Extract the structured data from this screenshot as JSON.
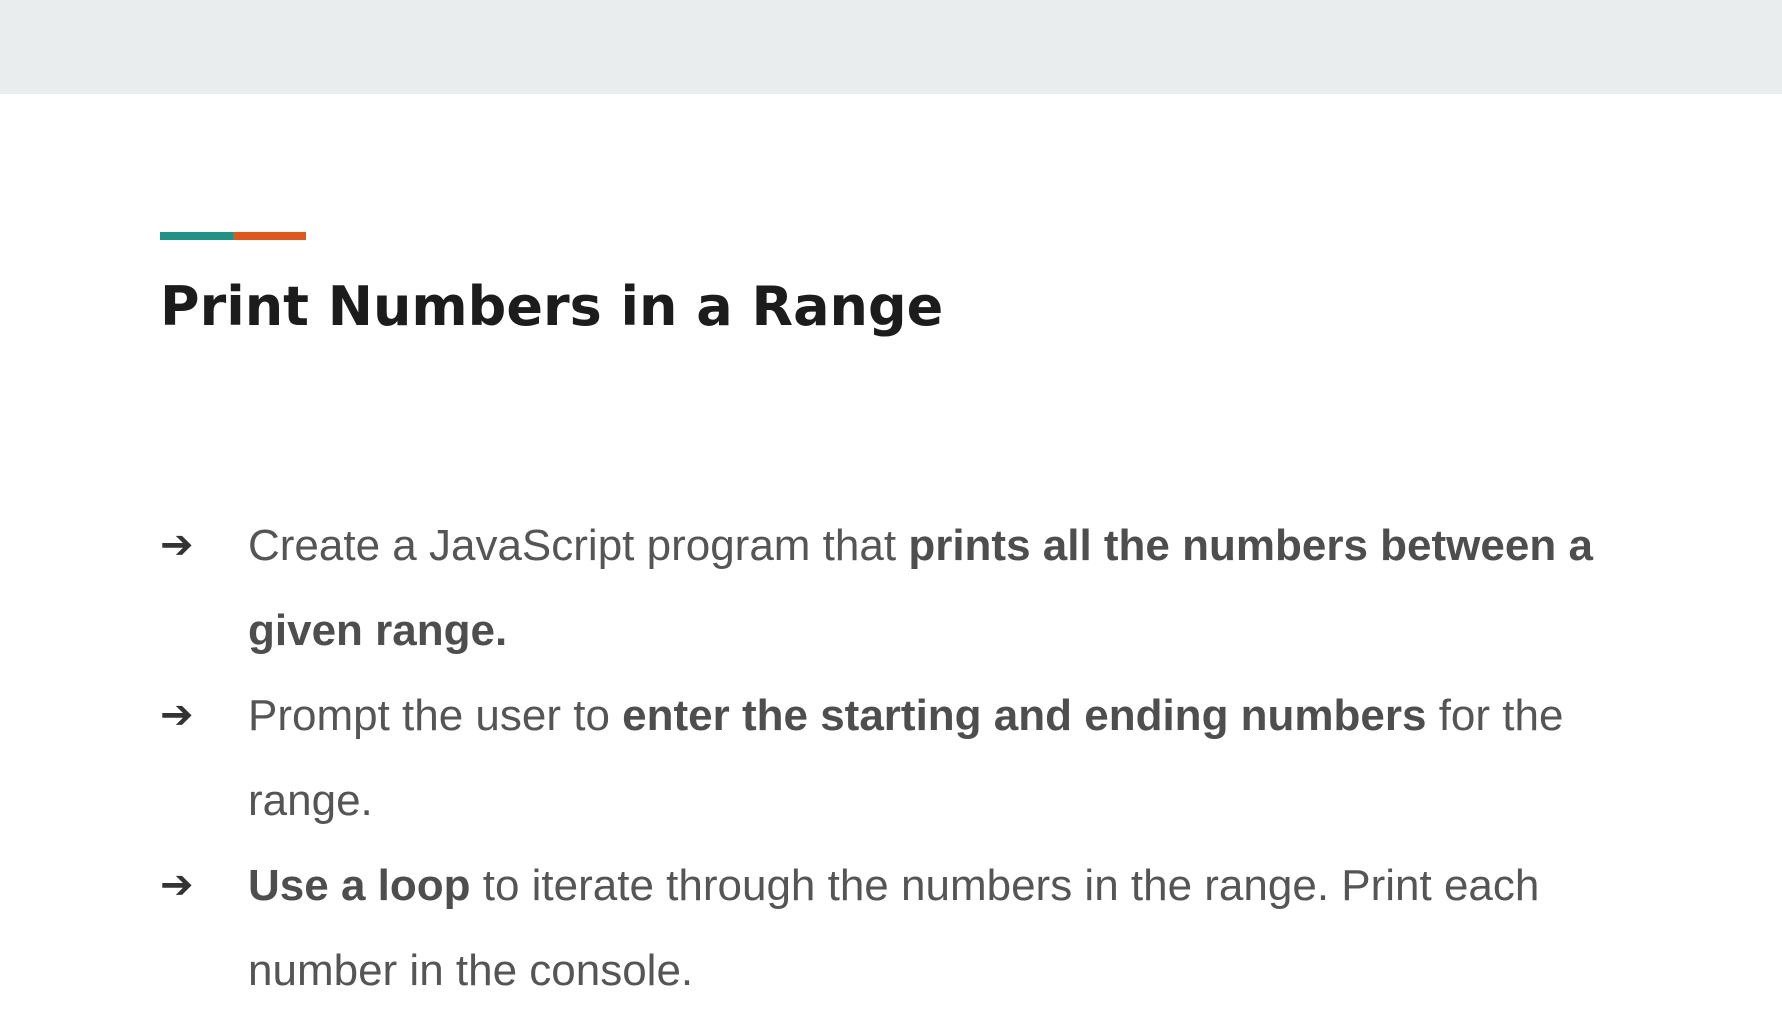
{
  "slide": {
    "title": "Print Numbers in a Range",
    "accent_colors": [
      "#1f9386",
      "#e0561b"
    ],
    "top_bar_color": "#e9edee",
    "bullet_icon": "arrow-right-icon",
    "bullets": [
      {
        "before": "Create a JavaScript program that ",
        "bold": "prints all the numbers between a given range.",
        "after": ""
      },
      {
        "before": "Prompt the user to ",
        "bold": "enter the starting and ending numbers",
        "after": " for the range."
      },
      {
        "before": "",
        "bold": "Use a loop",
        "after": " to iterate through the numbers in the range. Print each number in the console."
      }
    ]
  }
}
